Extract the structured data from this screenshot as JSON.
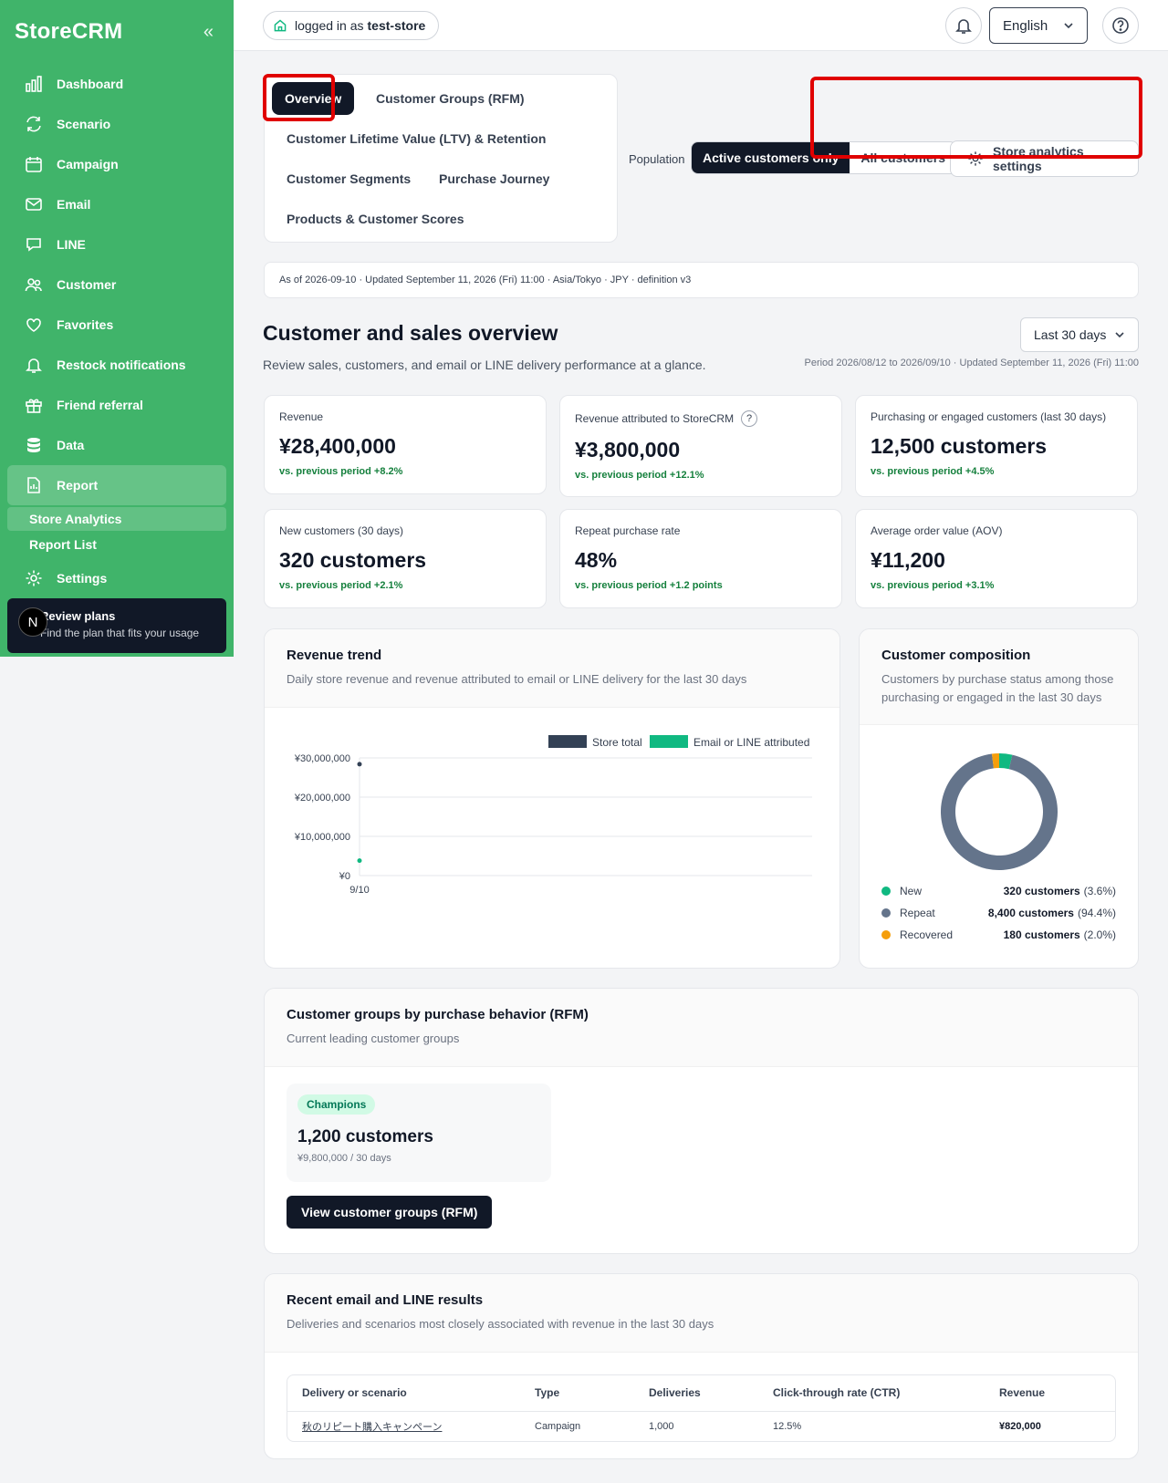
{
  "sidebar": {
    "logo": "StoreCRM",
    "items": [
      {
        "label": "Dashboard"
      },
      {
        "label": "Scenario"
      },
      {
        "label": "Campaign"
      },
      {
        "label": "Email"
      },
      {
        "label": "LINE"
      },
      {
        "label": "Customer"
      },
      {
        "label": "Favorites"
      },
      {
        "label": "Restock notifications"
      },
      {
        "label": "Friend referral"
      },
      {
        "label": "Data"
      },
      {
        "label": "Report"
      }
    ],
    "sub_items": [
      {
        "label": "Store Analytics"
      },
      {
        "label": "Report List"
      }
    ],
    "settings": "Settings",
    "plan": {
      "avatar": "N",
      "title": "Review plans",
      "subtitle": "Find the plan that fits your usage"
    }
  },
  "topbar": {
    "login_prefix": "logged in as",
    "store": "test-store",
    "language": "English"
  },
  "tabs": [
    {
      "label": "Overview"
    },
    {
      "label": "Customer Groups (RFM)"
    },
    {
      "label": "Customer Lifetime Value (LTV) & Retention"
    },
    {
      "label": "Customer Segments"
    },
    {
      "label": "Purchase Journey"
    },
    {
      "label": "Products & Customer Scores"
    }
  ],
  "population": {
    "label": "Population",
    "options": [
      {
        "label": "Active customers only"
      },
      {
        "label": "All customers"
      }
    ],
    "settings_label": "Store analytics settings"
  },
  "as_of": "As of 2026-09-10 · Updated September 11, 2026 (Fri) 11:00 · Asia/Tokyo · JPY · definition v3",
  "overview": {
    "title": "Customer and sales overview",
    "description": "Review sales, customers, and email or LINE delivery performance at a glance.",
    "range": "Last 30 days",
    "period": "Period 2026/08/12 to 2026/09/10 · Updated September 11, 2026 (Fri) 11:00"
  },
  "kpis": [
    {
      "label": "Revenue",
      "value": "¥28,400,000",
      "delta": "vs. previous period +8.2%"
    },
    {
      "label": "Revenue attributed to StoreCRM",
      "value": "¥3,800,000",
      "delta": "vs. previous period +12.1%"
    },
    {
      "label": "Purchasing or engaged customers (last 30 days)",
      "value": "12,500 customers",
      "delta": "vs. previous period +4.5%"
    },
    {
      "label": "New customers (30 days)",
      "value": "320 customers",
      "delta": "vs. previous period +2.1%"
    },
    {
      "label": "Repeat purchase rate",
      "value": "48%",
      "delta": "vs. previous period +1.2 points"
    },
    {
      "label": "Average order value (AOV)",
      "value": "¥11,200",
      "delta": "vs. previous period +3.1%"
    }
  ],
  "trend_card": {
    "title": "Revenue trend",
    "subtitle": "Daily store revenue and revenue attributed to email or LINE delivery for the last 30 days"
  },
  "composition_card": {
    "title": "Customer composition",
    "subtitle": "Customers by purchase status among those purchasing or engaged in the last 30 days",
    "legend": [
      {
        "label": "New",
        "count": "320 customers",
        "pct": "(3.6%)",
        "color": "#10b981"
      },
      {
        "label": "Repeat",
        "count": "8,400 customers",
        "pct": "(94.4%)",
        "color": "#64748b"
      },
      {
        "label": "Recovered",
        "count": "180 customers",
        "pct": "(2.0%)",
        "color": "#f59e0b"
      }
    ]
  },
  "rfm_card": {
    "title": "Customer groups by purchase behavior (RFM)",
    "subtitle": "Current leading customer groups",
    "tile": {
      "badge": "Champions",
      "value": "1,200 customers",
      "sub": "¥9,800,000 / 30 days"
    },
    "button": "View customer groups (RFM)"
  },
  "results_card": {
    "title": "Recent email and LINE results",
    "subtitle": "Deliveries and scenarios most closely associated with revenue in the last 30 days",
    "columns": [
      "Delivery or scenario",
      "Type",
      "Deliveries",
      "Click-through rate (CTR)",
      "Revenue"
    ],
    "rows": [
      [
        "秋のリピート購入キャンペーン",
        "Campaign",
        "1,000",
        "12.5%",
        "¥820,000"
      ]
    ]
  },
  "chart_data": [
    {
      "type": "line",
      "title": "",
      "xlabel": "",
      "ylabel": "",
      "x": [
        "9/10"
      ],
      "series": [
        {
          "name": "Store total",
          "values": [
            28400000
          ],
          "color": "#334155"
        },
        {
          "name": "Email or LINE attributed",
          "values": [
            3800000
          ],
          "color": "#10b981"
        }
      ],
      "ylim": [
        0,
        30000000
      ],
      "yticks": [
        "¥30,000,000",
        "¥20,000,000",
        "¥10,000,000",
        "¥0"
      ],
      "grid": true,
      "legend": "top-right"
    },
    {
      "type": "pie",
      "donut": true,
      "categories": [
        "New",
        "Repeat",
        "Recovered"
      ],
      "values": [
        3.6,
        94.4,
        2.0
      ],
      "colors": [
        "#10b981",
        "#64748b",
        "#f59e0b"
      ]
    }
  ]
}
